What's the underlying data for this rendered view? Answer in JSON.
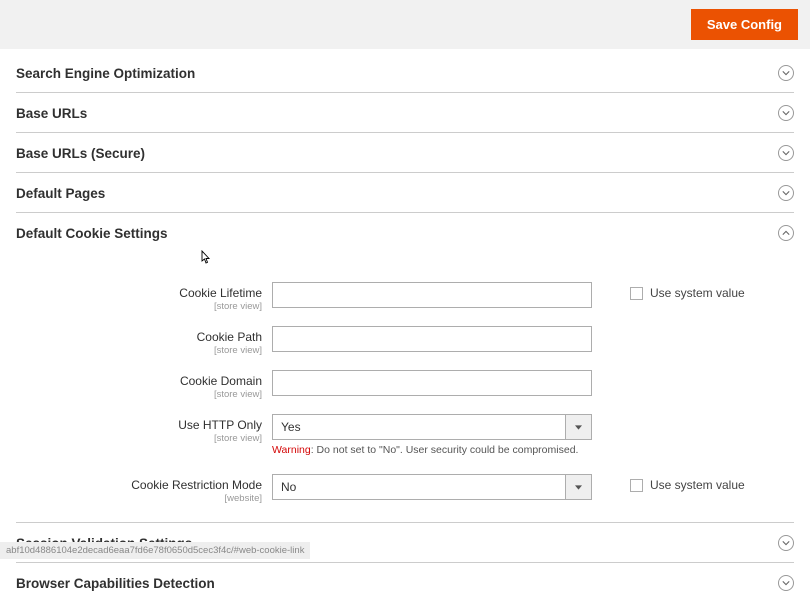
{
  "header": {
    "save_button": "Save Config"
  },
  "sections": {
    "seo": {
      "title": "Search Engine Optimization"
    },
    "base_urls": {
      "title": "Base URLs"
    },
    "base_urls_secure": {
      "title": "Base URLs (Secure)"
    },
    "default_pages": {
      "title": "Default Pages"
    },
    "default_cookie": {
      "title": "Default Cookie Settings"
    },
    "session_validation": {
      "title": "Session Validation Settings"
    },
    "browser_cap": {
      "title": "Browser Capabilities Detection"
    }
  },
  "cookie_settings": {
    "cookie_lifetime": {
      "label": "Cookie Lifetime",
      "scope": "[store view]",
      "value": "",
      "use_system_label": "Use system value"
    },
    "cookie_path": {
      "label": "Cookie Path",
      "scope": "[store view]",
      "value": ""
    },
    "cookie_domain": {
      "label": "Cookie Domain",
      "scope": "[store view]",
      "value": ""
    },
    "use_http_only": {
      "label": "Use HTTP Only",
      "scope": "[store view]",
      "value": "Yes",
      "warning_prefix": "Warning",
      "warning_text": ": Do not set to \"No\". User security could be compromised."
    },
    "cookie_restriction": {
      "label": "Cookie Restriction Mode",
      "scope": "[website]",
      "value": "No",
      "use_system_label": "Use system value"
    }
  },
  "status_bar": "abf10d4886104e2decad6eaa7fd6e78f0650d5cec3f4c/#web-cookie-link"
}
